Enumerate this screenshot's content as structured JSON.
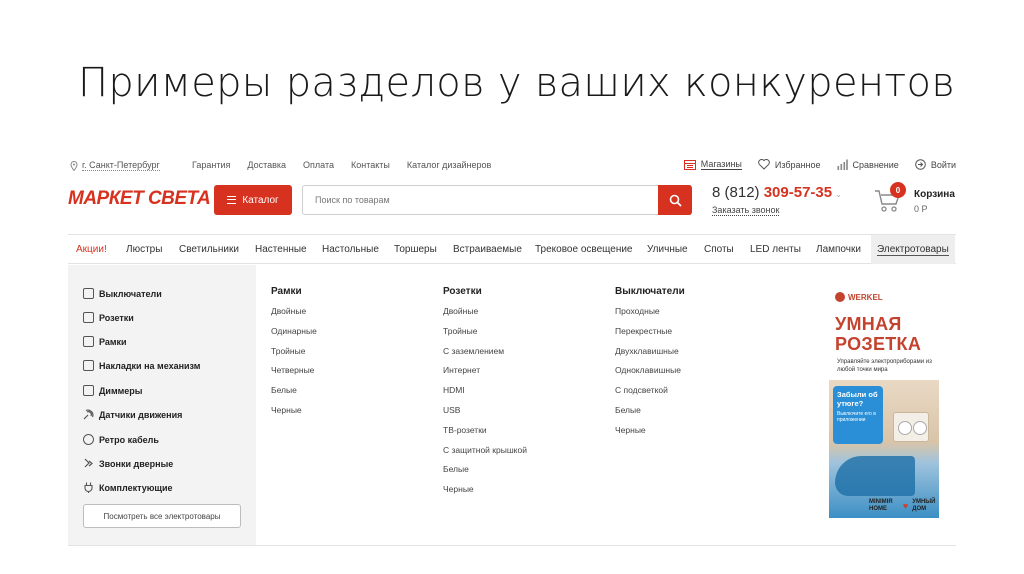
{
  "slide": {
    "title": "Примеры разделов у ваших конкурентов"
  },
  "topbar": {
    "city": "г. Санкт-Петербург",
    "links": [
      "Гарантия",
      "Доставка",
      "Оплата",
      "Контакты",
      "Каталог дизайнеров"
    ],
    "shops": "Магазины",
    "favorites": "Избранное",
    "compare": "Сравнение",
    "login": "Войти"
  },
  "header": {
    "logo": "МАРКЕТ СВЕТА",
    "catalog_label": "Каталог",
    "search_placeholder": "Поиск по товарам",
    "phone_prefix": "8 (812)",
    "phone_number": "309-57-35",
    "callback": "Заказать звонок",
    "cart_count": "0",
    "cart_label": "Корзина",
    "cart_sum": "0 Р"
  },
  "nav": {
    "items": [
      "Акции!",
      "Люстры",
      "Светильники",
      "Настенные",
      "Настольные",
      "Торшеры",
      "Встраиваемые",
      "Трековое освещение",
      "Уличные",
      "Споты",
      "LED ленты",
      "Лампочки",
      "Электротовары"
    ]
  },
  "sidebar": {
    "items": [
      "Выключатели",
      "Розетки",
      "Рамки",
      "Накладки на механизм",
      "Диммеры",
      "Датчики движения",
      "Ретро кабель",
      "Звонки дверные",
      "Комплектующие"
    ],
    "all_button": "Посмотреть все электротовары"
  },
  "columns": [
    {
      "title": "Рамки",
      "links": [
        "Двойные",
        "Одинарные",
        "Тройные",
        "Четверные",
        "Белые",
        "Черные"
      ]
    },
    {
      "title": "Розетки",
      "links": [
        "Двойные",
        "Тройные",
        "С заземлением",
        "Интернет",
        "HDMI",
        "USB",
        "ТВ-розетки",
        "С защитной крышкой",
        "Белые",
        "Черные"
      ]
    },
    {
      "title": "Выключатели",
      "links": [
        "Проходные",
        "Перекрестные",
        "Двухклавишные",
        "Одноклавишные",
        "С подсветкой",
        "Белые",
        "Черные"
      ]
    }
  ],
  "promo": {
    "brand": "WERKEL",
    "headline_1": "УМНАЯ",
    "headline_2": "РОЗЕТКА",
    "subline": "Управляйте электроприборами из любой точки мира",
    "bubble_title": "Забыли об утюге?",
    "bubble_text": "Выключите его в приложении",
    "footer_left": "MINIMIR HOME",
    "footer_right": "УМНЫЙ ДОМ"
  },
  "colors": {
    "accent": "#d7321f",
    "sidebar_bg": "#f3f3f3",
    "promo_red": "#c3432e"
  }
}
